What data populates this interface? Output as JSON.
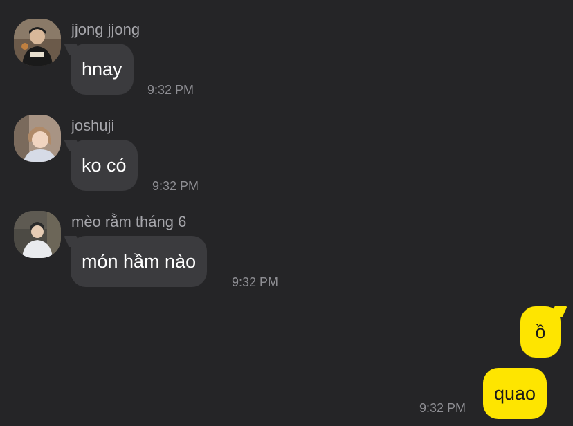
{
  "messages_incoming": [
    {
      "sender": "jjong jjong",
      "text": "hnay",
      "time": "9:32 PM",
      "avatar": "avatar-icon-jjong"
    },
    {
      "sender": "joshuji",
      "text": "ko có",
      "time": "9:32 PM",
      "avatar": "avatar-icon-joshuji"
    },
    {
      "sender": "mèo rằm tháng 6",
      "text": "món hầm nào",
      "time": "9:32 PM",
      "avatar": "avatar-icon-meo"
    }
  ],
  "messages_outgoing": [
    {
      "text": "ồ"
    },
    {
      "text": "quao",
      "time": "9:32 PM"
    }
  ],
  "colors": {
    "background": "#252527",
    "incoming_bubble": "#3b3b3e",
    "outgoing_bubble": "#fee500",
    "sender_name": "#a6a6ab",
    "timestamp": "#8e8e93"
  }
}
